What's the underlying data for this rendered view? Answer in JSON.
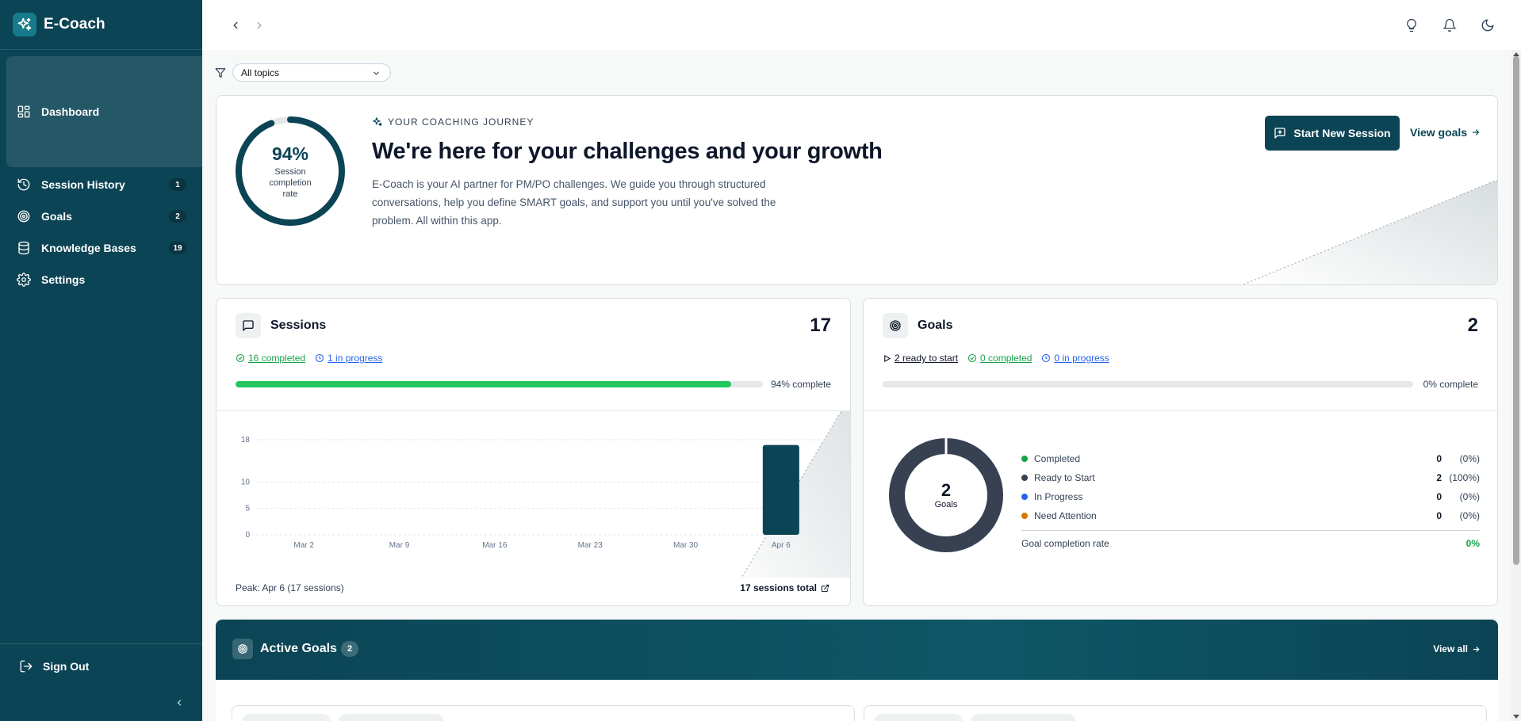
{
  "app": {
    "name": "E-Coach"
  },
  "sidebar": {
    "items": [
      {
        "label": "Dashboard",
        "icon": "dashboard-icon",
        "active": true
      },
      {
        "label": "Session History",
        "icon": "history-icon",
        "badge": "1"
      },
      {
        "label": "Goals",
        "icon": "target-icon",
        "badge": "2"
      },
      {
        "label": "Knowledge Bases",
        "icon": "database-icon",
        "badge": "19"
      },
      {
        "label": "Settings",
        "icon": "gear-icon"
      }
    ],
    "sign_out": "Sign Out"
  },
  "filter": {
    "selected": "All topics"
  },
  "hero": {
    "ring_percent": "94%",
    "ring_value": 0.94,
    "ring_label": "Session completion rate",
    "eyebrow": "YOUR COACHING JOURNEY",
    "title": "We're here for your challenges and your growth",
    "description": "E-Coach is your AI partner for PM/PO challenges. We guide you through structured conversations, help you define SMART goals, and support you until you've solved the problem. All within this app.",
    "primary_button": "Start New Session",
    "secondary_link": "View goals"
  },
  "sessions": {
    "title": "Sessions",
    "count": "17",
    "completed": "16 completed",
    "in_progress": "1 in progress",
    "progress": 0.94,
    "progress_label": "94% complete",
    "peak": "Peak: Apr 6 (17 sessions)",
    "total": "17 sessions total"
  },
  "chart_data": {
    "type": "bar",
    "categories": [
      "Mar 2",
      "Mar 9",
      "Mar 16",
      "Mar 23",
      "Mar 30",
      "Apr 6"
    ],
    "values": [
      0,
      0,
      0,
      0,
      0,
      17
    ],
    "yticks": [
      0,
      5,
      10,
      18
    ],
    "ylim": [
      0,
      18
    ],
    "grid": true,
    "bar_color": "#0b4455"
  },
  "goals": {
    "title": "Goals",
    "count": "2",
    "ready": "2 ready to start",
    "completed": "0 completed",
    "in_progress": "0 in progress",
    "progress": 0,
    "progress_label": "0% complete",
    "donut_number": "2",
    "donut_label": "Goals",
    "legend": [
      {
        "name": "Completed",
        "value": "0",
        "pct": "(0%)",
        "color": "#16a34a"
      },
      {
        "name": "Ready to Start",
        "value": "2",
        "pct": "(100%)",
        "color": "#374151"
      },
      {
        "name": "In Progress",
        "value": "0",
        "pct": "(0%)",
        "color": "#2563eb"
      },
      {
        "name": "Need Attention",
        "value": "0",
        "pct": "(0%)",
        "color": "#d97706"
      }
    ],
    "rate_label": "Goal completion rate",
    "rate_value": "0%"
  },
  "active_goals": {
    "title": "Active Goals",
    "badge": "2",
    "view_all": "View all"
  },
  "colors": {
    "brand": "#0b4455",
    "progress_green": "#22c55e",
    "donut": "#374151"
  }
}
